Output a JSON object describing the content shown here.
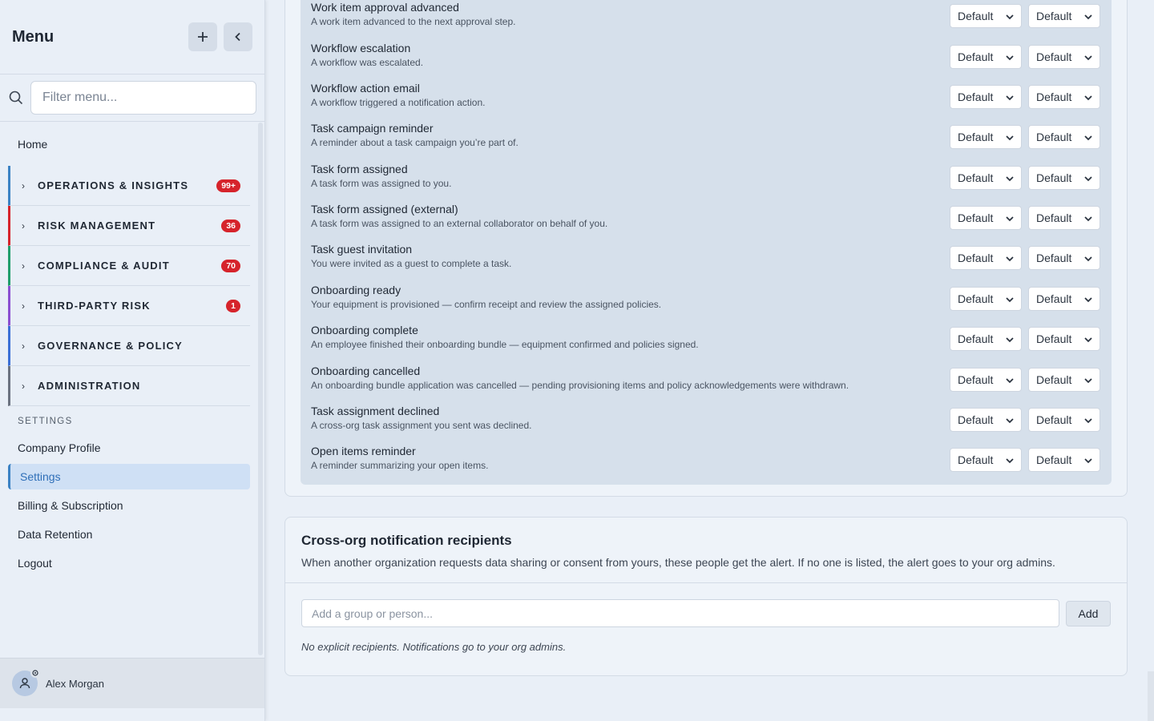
{
  "sidebar": {
    "title": "Menu",
    "filter_placeholder": "Filter menu...",
    "home": "Home",
    "groups": [
      {
        "label": "OPERATIONS & INSIGHTS",
        "badge": "99+",
        "color": "#3b82c4"
      },
      {
        "label": "RISK MANAGEMENT",
        "badge": "36",
        "color": "#d6232b"
      },
      {
        "label": "COMPLIANCE & AUDIT",
        "badge": "70",
        "color": "#1f9d6b"
      },
      {
        "label": "THIRD-PARTY RISK",
        "badge": "1",
        "color": "#8b4fd1"
      },
      {
        "label": "GOVERNANCE & POLICY",
        "badge": "",
        "color": "#3b6fd6"
      },
      {
        "label": "ADMINISTRATION",
        "badge": "",
        "color": "#6b7280"
      }
    ],
    "settings_label": "SETTINGS",
    "settings_links": [
      "Company Profile",
      "Settings",
      "Billing & Subscription",
      "Data Retention",
      "Logout"
    ],
    "active_link": "Settings",
    "user_name": "Alex Morgan"
  },
  "notifications": [
    {
      "title": "Work item approval advanced",
      "desc": "A work item advanced to the next approval step.",
      "opt1": "Default",
      "opt2": "Default"
    },
    {
      "title": "Workflow escalation",
      "desc": "A workflow was escalated.",
      "opt1": "Default",
      "opt2": "Default"
    },
    {
      "title": "Workflow action email",
      "desc": "A workflow triggered a notification action.",
      "opt1": "Default",
      "opt2": "Default"
    },
    {
      "title": "Task campaign reminder",
      "desc": "A reminder about a task campaign you’re part of.",
      "opt1": "Default",
      "opt2": "Default"
    },
    {
      "title": "Task form assigned",
      "desc": "A task form was assigned to you.",
      "opt1": "Default",
      "opt2": "Default"
    },
    {
      "title": "Task form assigned (external)",
      "desc": "A task form was assigned to an external collaborator on behalf of you.",
      "opt1": "Default",
      "opt2": "Default"
    },
    {
      "title": "Task guest invitation",
      "desc": "You were invited as a guest to complete a task.",
      "opt1": "Default",
      "opt2": "Default"
    },
    {
      "title": "Onboarding ready",
      "desc": "Your equipment is provisioned — confirm receipt and review the assigned policies.",
      "opt1": "Default",
      "opt2": "Default"
    },
    {
      "title": "Onboarding complete",
      "desc": "An employee finished their onboarding bundle — equipment confirmed and policies signed.",
      "opt1": "Default",
      "opt2": "Default"
    },
    {
      "title": "Onboarding cancelled",
      "desc": "An onboarding bundle application was cancelled — pending provisioning items and policy acknowledgements were withdrawn.",
      "opt1": "Default",
      "opt2": "Default"
    },
    {
      "title": "Task assignment declined",
      "desc": "A cross-org task assignment you sent was declined.",
      "opt1": "Default",
      "opt2": "Default"
    },
    {
      "title": "Open items reminder",
      "desc": "A reminder summarizing your open items.",
      "opt1": "Default",
      "opt2": "Default"
    }
  ],
  "recipients": {
    "title": "Cross-org notification recipients",
    "subtitle": "When another organization requests data sharing or consent from yours, these people get the alert. If no one is listed, the alert goes to your org admins.",
    "input_placeholder": "Add a group or person...",
    "add_label": "Add",
    "empty_note": "No explicit recipients. Notifications go to your org admins."
  }
}
